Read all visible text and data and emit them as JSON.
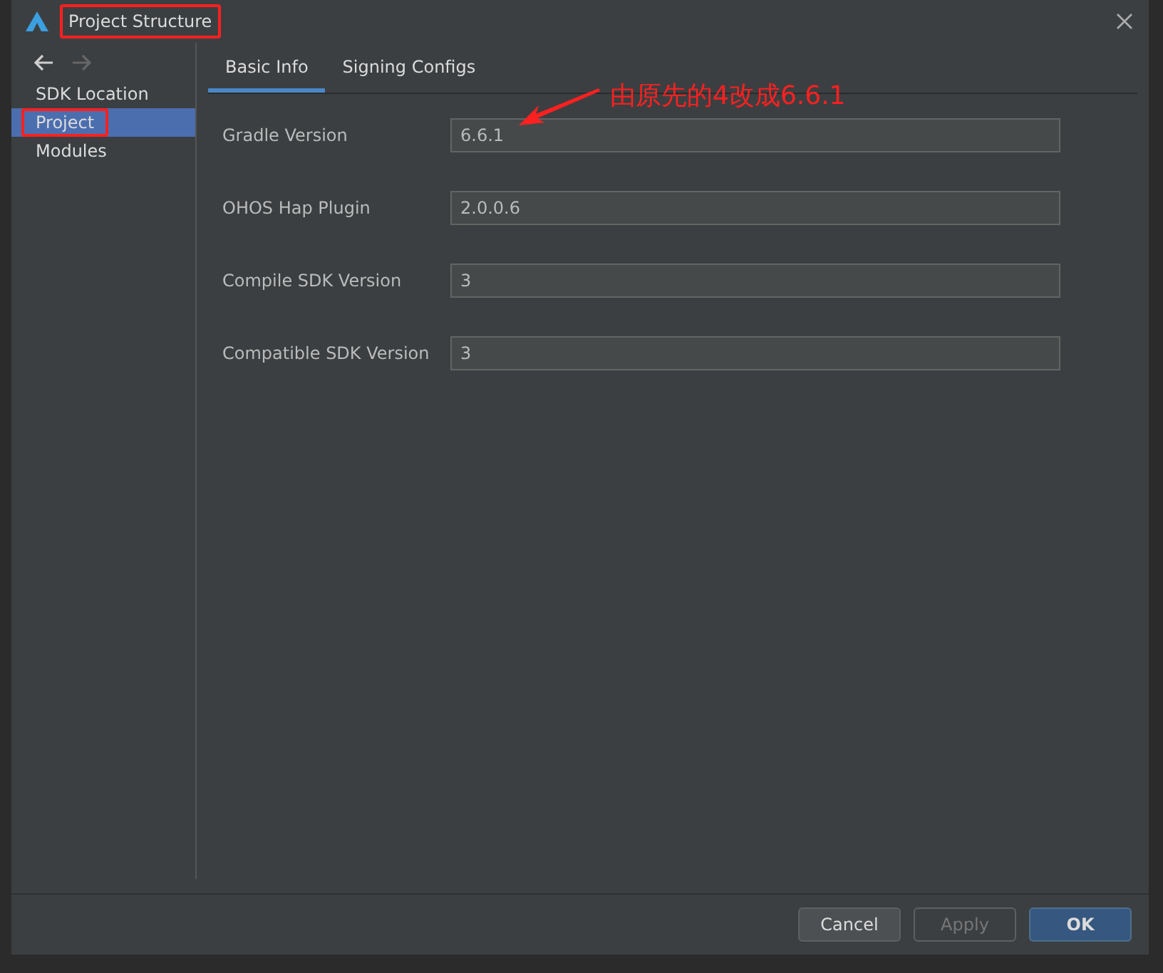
{
  "window": {
    "title": "Project Structure",
    "title_highlighted": true
  },
  "sidebar": {
    "items": [
      {
        "label": "SDK Location",
        "selected": false,
        "highlighted": false
      },
      {
        "label": "Project",
        "selected": true,
        "highlighted": true
      },
      {
        "label": "Modules",
        "selected": false,
        "highlighted": false
      }
    ]
  },
  "tabs": [
    {
      "label": "Basic Info",
      "selected": true
    },
    {
      "label": "Signing Configs",
      "selected": false
    }
  ],
  "fields": [
    {
      "label": "Gradle Version",
      "value": "6.6.1"
    },
    {
      "label": "OHOS Hap Plugin",
      "value": "2.0.0.6"
    },
    {
      "label": "Compile SDK Version",
      "value": "3"
    },
    {
      "label": "Compatible SDK Version",
      "value": "3"
    }
  ],
  "annotation": {
    "text": "由原先的4改成6.6.1"
  },
  "buttons": [
    {
      "label": "Cancel",
      "kind": "normal",
      "disabled": false
    },
    {
      "label": "Apply",
      "kind": "normal",
      "disabled": true
    },
    {
      "label": "OK",
      "kind": "default",
      "disabled": false
    }
  ]
}
